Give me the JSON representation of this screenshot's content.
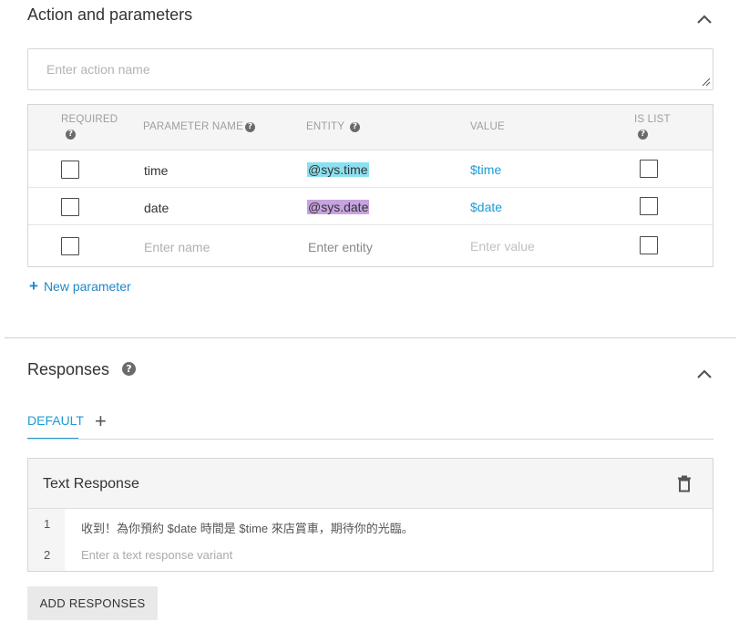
{
  "action_section": {
    "title": "Action and parameters",
    "action_input_placeholder": "Enter action name"
  },
  "params_table": {
    "headers": {
      "required": "REQUIRED",
      "parameter_name": "PARAMETER NAME",
      "entity": "ENTITY",
      "value": "VALUE",
      "is_list": "IS LIST"
    },
    "rows": [
      {
        "required": false,
        "name": "time",
        "entity": "@sys.time",
        "entity_color": "#8ce0f0",
        "value": "$time",
        "is_list": false
      },
      {
        "required": false,
        "name": "date",
        "entity": "@sys.date",
        "entity_color": "#c7a3e0",
        "value": "$date",
        "is_list": false
      }
    ],
    "empty_row": {
      "name_placeholder": "Enter name",
      "entity_placeholder": "Enter entity",
      "value_placeholder": "Enter value"
    },
    "new_parameter_label": "New parameter"
  },
  "responses_section": {
    "title": "Responses",
    "tabs": [
      {
        "label": "DEFAULT",
        "active": true
      }
    ],
    "text_response": {
      "title": "Text Response",
      "lines": [
        {
          "number": "1",
          "text": "收到！為你預約 $date 時間是 $time 來店賞車，期待你的光臨。"
        },
        {
          "number": "2",
          "placeholder": "Enter a text response variant"
        }
      ]
    },
    "add_responses_label": "ADD RESPONSES"
  },
  "colors": {
    "accent": "#1e9ad6",
    "link": "#1e88c8"
  }
}
